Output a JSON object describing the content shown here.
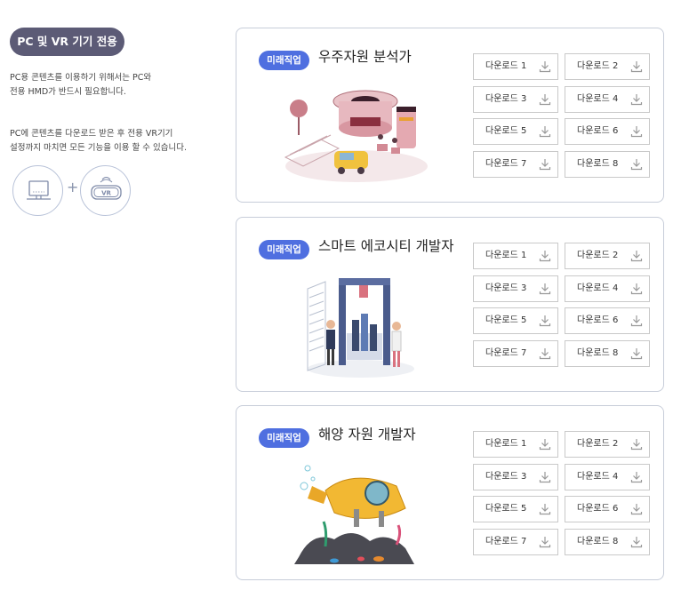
{
  "sidebar": {
    "pill_label": "PC 및 VR 기기 전용",
    "desc1": "PC용 콘텐츠를 이용하기 위해서는 PC와\n전용 HMD가 반드시 필요합니다.",
    "desc2": "PC에 콘텐츠를 다운로드 받은 후 전용 VR기기\n설정까지 마치면 모든 기능을 이용 할 수 있습니다.",
    "plus": "+",
    "vr_label": "VR",
    "pc_icon": "pc-monitor-icon",
    "vr_icon": "vr-headset-icon"
  },
  "colors": {
    "pill_bg": "#5c5b76",
    "badge_bg": "#4f6fe0",
    "card_border": "#c7cdd9"
  },
  "cards": [
    {
      "badge": "미래직업",
      "title": "우주자원 분석가",
      "illustration": "space-base-illustration",
      "downloads": [
        "다운로드 1",
        "다운로드 2",
        "다운로드 3",
        "다운로드 4",
        "다운로드 5",
        "다운로드 6",
        "다운로드 7",
        "다운로드 8"
      ]
    },
    {
      "badge": "미래직업",
      "title": "스마트 에코시티 개발자",
      "illustration": "smart-city-illustration",
      "downloads": [
        "다운로드 1",
        "다운로드 2",
        "다운로드 3",
        "다운로드 4",
        "다운로드 5",
        "다운로드 6",
        "다운로드 7",
        "다운로드 8"
      ]
    },
    {
      "badge": "미래직업",
      "title": "해양 자원 개발자",
      "illustration": "submarine-illustration",
      "downloads": [
        "다운로드 1",
        "다운로드 2",
        "다운로드 3",
        "다운로드 4",
        "다운로드 5",
        "다운로드 6",
        "다운로드 7",
        "다운로드 8"
      ]
    }
  ]
}
